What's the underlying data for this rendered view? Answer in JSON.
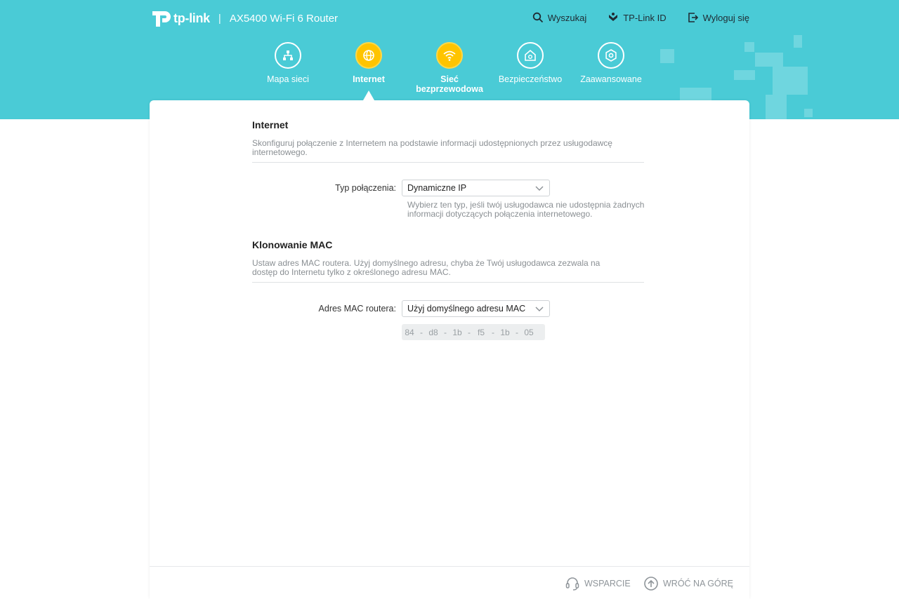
{
  "header": {
    "brand": "tp-link",
    "separator": "|",
    "model": "AX5400 Wi-Fi 6 Router",
    "links": {
      "search": "Wyszukaj",
      "tplink_id": "TP-Link ID",
      "logout": "Wyloguj się"
    }
  },
  "nav": {
    "network_map": "Mapa sieci",
    "internet": "Internet",
    "wireless_line1": "Sieć",
    "wireless_line2": "bezprzewodowa",
    "security": "Bezpieczeństwo",
    "advanced": "Zaawansowane",
    "active": "Internet"
  },
  "internet_section": {
    "title": "Internet",
    "description": "Skonfiguruj połączenie z Internetem na podstawie informacji udostępnionych przez usługodawcę internetowego.",
    "connection_type_label": "Typ połączenia:",
    "connection_type_value": "Dynamiczne IP",
    "connection_type_hint": "Wybierz ten typ, jeśli twój usługodawca nie udostępnia żadnych informacji dotyczących połączenia internetowego."
  },
  "mac_section": {
    "title": "Klonowanie MAC",
    "description": "Ustaw adres MAC routera. Użyj domyślnego adresu, chyba że Twój usługodawca zezwala na dostęp do Internetu tylko z określonego adresu MAC.",
    "router_mac_label": "Adres MAC routera:",
    "router_mac_value": "Użyj domyślnego adresu MAC",
    "mac_octets": [
      "84",
      "d8",
      "1b",
      "f5",
      "1b",
      "05"
    ],
    "mac_separator": "-"
  },
  "footer": {
    "support": "WSPARCIE",
    "back_to_top": "WRÓĆ NA GÓRĘ"
  },
  "colors": {
    "header_bg": "#4acbd6",
    "active_nav": "#ffc400"
  }
}
